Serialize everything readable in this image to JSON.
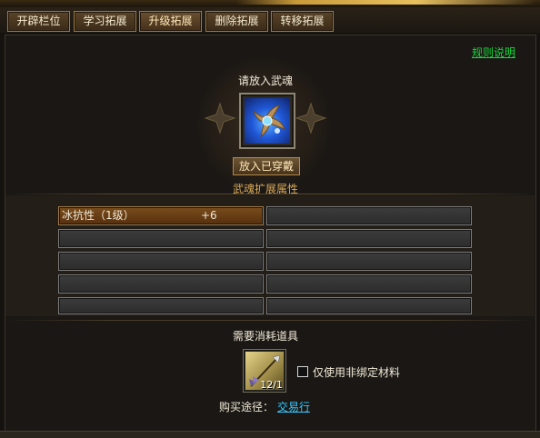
{
  "tabs": [
    {
      "label": "开辟栏位"
    },
    {
      "label": "学习拓展"
    },
    {
      "label": "升级拓展"
    },
    {
      "label": "删除拓展"
    },
    {
      "label": "转移拓展"
    }
  ],
  "rules_link": "规则说明",
  "soul_slot": {
    "prompt": "请放入武魂",
    "icon": "weapon-soul-icon"
  },
  "equip_button": "放入已穿戴",
  "section_title": "武魂扩展属性",
  "attributes": [
    {
      "name": "冰抗性（1级）",
      "value": "+6"
    }
  ],
  "consumables": {
    "label": "需要消耗道具",
    "item_icon": "arrow-feather-icon",
    "item_count": "12/1",
    "checkbox_label": "仅使用非绑定材料",
    "checkbox_checked": false,
    "buy_label": "购买途径：",
    "buy_link": "交易行"
  },
  "colors": {
    "accent_gold": "#d9a95a",
    "link_green": "#18d83c",
    "link_blue": "#36c8ff"
  }
}
